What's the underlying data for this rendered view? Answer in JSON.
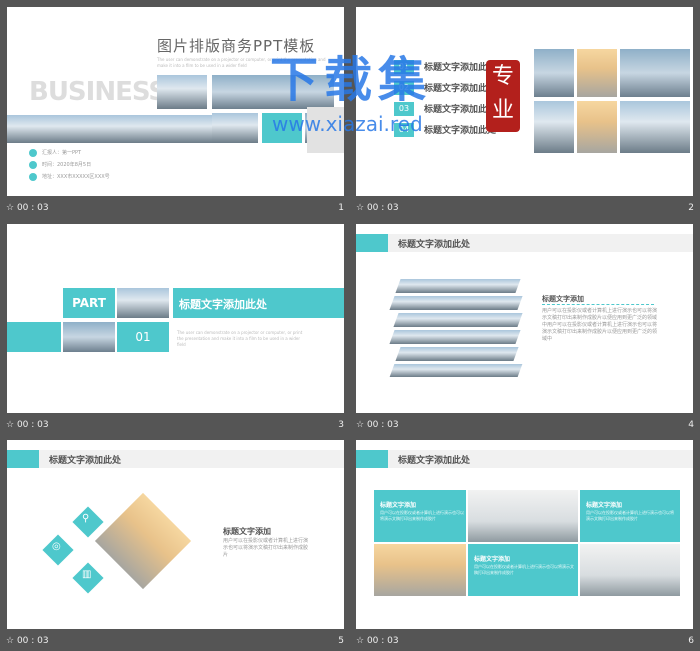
{
  "slides": [
    {
      "num": "1",
      "time": "00 : 03",
      "title": "图片排版商务PPT模板",
      "eng": "BUSINESS",
      "subtitle": "The user can demonstrate on a projector or computer, or print the presentation and make it into a film to be used in a wider field",
      "info": [
        "汇报人：第一PPT",
        "时间：2020年8月5日",
        "地址：XXX市XXXXX区XXX号"
      ]
    },
    {
      "num": "2",
      "time": "00 : 03",
      "items": [
        {
          "n": "01",
          "t": "标题文字添加此处"
        },
        {
          "n": "02",
          "t": "标题文字添加此处"
        },
        {
          "n": "03",
          "t": "标题文字添加此处"
        },
        {
          "n": "04",
          "t": "标题文字添加此处"
        }
      ]
    },
    {
      "num": "3",
      "time": "00 : 03",
      "part": "PART",
      "pnum": "01",
      "title": "标题文字添加此处",
      "sub": "The user can demonstrate on a projector or computer, or print the presentation and make it into a film to be used in a wider field"
    },
    {
      "num": "4",
      "time": "00 : 03",
      "header": "标题文字添加此处",
      "subhead": "标题文字添加",
      "body": "用户可以在投影仪或者计算机上进行演示也可以将演示文稿打印出来制作成胶片以便应用到更广泛的领域中用户可以在投影仪或者计算机上进行演示也可以将演示文稿打印出来制作成胶片以便应用到更广泛的领域中"
    },
    {
      "num": "5",
      "time": "00 : 03",
      "header": "标题文字添加此处",
      "subhead": "标题文字添加",
      "body": "用户可以在投影仪或者计算机上进行演示也可以将演示文稿打印出来制作成胶片"
    },
    {
      "num": "6",
      "time": "00 : 03",
      "header": "标题文字添加此处",
      "cells": [
        {
          "t": "标题文字添加",
          "b": "用户可以在投影仪或者计算机上进行演示也可以将演示文稿打印出来制作成胶片"
        },
        {
          "t": "标题文字添加",
          "b": "用户可以在投影仪或者计算机上进行演示也可以将演示文稿打印出来制作成胶片"
        },
        {
          "t": "标题文字添加",
          "b": "用户可以在投影仪或者计算机上进行演示也可以将演示文稿打印出来制作成胶片"
        }
      ]
    }
  ],
  "watermark": {
    "cn": "下载集",
    "url": "www.xiazai.red",
    "seal": "专业"
  }
}
